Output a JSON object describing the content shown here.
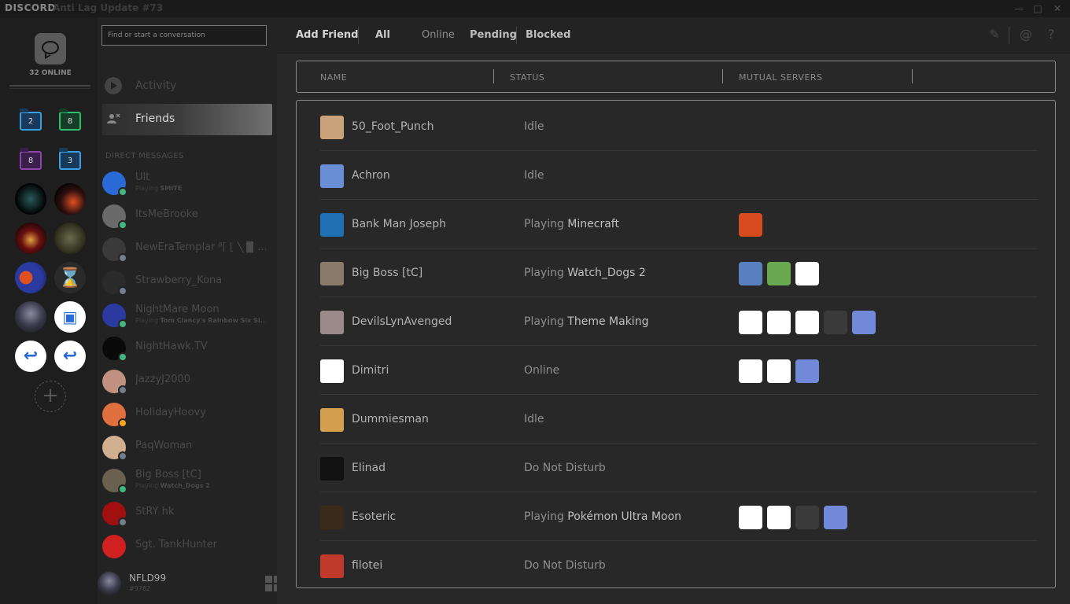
{
  "titlebar": {
    "brand": "DISCORD",
    "title": "Anti Lag Update #73",
    "minimize_icon": "minimize-icon",
    "maximize_icon": "maximize-icon",
    "close_icon": "close-icon"
  },
  "guilds": {
    "online_count": "32 ONLINE",
    "folders": [
      {
        "count": "2",
        "color": "#3aa0e6"
      },
      {
        "count": "8",
        "color": "#2fbf71"
      },
      {
        "count": "8",
        "color": "#8e44ad"
      },
      {
        "count": "3",
        "color": "#3aa0e6"
      }
    ],
    "add_server_icon": "plus-icon"
  },
  "dm": {
    "search_placeholder": "Find or start a conversation",
    "nav": [
      {
        "label": "Activity",
        "icon": "play-icon"
      },
      {
        "label": "Friends",
        "icon": "friends-icon"
      }
    ],
    "header": "DIRECT MESSAGES",
    "items": [
      {
        "name": "Ult",
        "sub_prefix": "Playing ",
        "sub_game": "SMITE",
        "status_color": "#43b581"
      },
      {
        "name": "ItsMeBrooke",
        "sub_prefix": "",
        "sub_game": "",
        "status_color": "#43b581"
      },
      {
        "name": "NewEraTemplar ᵝ⌈ ⌊ ╲ ▉ ...",
        "sub_prefix": "",
        "sub_game": "",
        "status_color": "#747f8d"
      },
      {
        "name": "Strawberry_Kona",
        "sub_prefix": "",
        "sub_game": "",
        "status_color": "#747f8d"
      },
      {
        "name": "NightMare Moon",
        "sub_prefix": "Playing ",
        "sub_game": "Tom Clancy's Rainbow Six Si...",
        "status_color": "#43b581"
      },
      {
        "name": "NightHawk.TV",
        "sub_prefix": "",
        "sub_game": "",
        "status_color": "#43b581"
      },
      {
        "name": "JazzyJ2000",
        "sub_prefix": "",
        "sub_game": "",
        "status_color": "#747f8d"
      },
      {
        "name": "HolidayHoovy",
        "sub_prefix": "",
        "sub_game": "",
        "status_color": "#faa61a"
      },
      {
        "name": "PaqWoman",
        "sub_prefix": "",
        "sub_game": "",
        "status_color": "#747f8d"
      },
      {
        "name": "Big Boss [tC]",
        "sub_prefix": "Playing ",
        "sub_game": "Watch_Dogs 2",
        "status_color": "#43b581"
      },
      {
        "name": "StRY hk",
        "sub_prefix": "",
        "sub_game": "",
        "status_color": "#747f8d"
      },
      {
        "name": "Sgt. TankHunter",
        "sub_prefix": "",
        "sub_game": "",
        "status_color": ""
      }
    ],
    "user": {
      "name": "NFLD99",
      "discriminator": "#9782"
    }
  },
  "topbar": {
    "tabs": [
      "Add Friend",
      "All",
      "Online",
      "Pending",
      "Blocked"
    ],
    "icons": [
      "new-group-icon",
      "mention-icon",
      "help-icon"
    ]
  },
  "table": {
    "headers": [
      "NAME",
      "STATUS",
      "MUTUAL SERVERS"
    ],
    "rows": [
      {
        "name": "50_Foot_Punch",
        "status": "Idle",
        "game": "",
        "avatar_color": "#c9a27a",
        "servers": []
      },
      {
        "name": "Achron",
        "status": "Idle",
        "game": "",
        "avatar_color": "#6b8fd6",
        "servers": []
      },
      {
        "name": "Bank Man Joseph",
        "status": "Playing ",
        "game": "Minecraft",
        "avatar_color": "#1e6fb3",
        "servers": [
          "#d64a1e"
        ]
      },
      {
        "name": "Big Boss [tC]",
        "status": "Playing ",
        "game": "Watch_Dogs 2",
        "avatar_color": "#8a7a6a",
        "servers": [
          "#5a7fc0",
          "#6aa84f",
          "#ffffff"
        ]
      },
      {
        "name": "DevilsLynAvenged",
        "status": "Playing ",
        "game": "Theme Making",
        "avatar_color": "#9a8a8a",
        "servers": [
          "#ffffff",
          "#ffffff",
          "#ffffff",
          "#3a3a3a",
          "#7289da"
        ]
      },
      {
        "name": "Dimitri",
        "status": "Online",
        "game": "",
        "avatar_color": "#ffffff",
        "servers": [
          "#ffffff",
          "#ffffff",
          "#7289da"
        ]
      },
      {
        "name": "Dummiesman",
        "status": "Idle",
        "game": "",
        "avatar_color": "#d4a050",
        "servers": []
      },
      {
        "name": "Elinad",
        "status": "Do Not Disturb",
        "game": "",
        "avatar_color": "#111111",
        "servers": []
      },
      {
        "name": "Esoteric",
        "status": "Playing ",
        "game": "Pokémon Ultra Moon",
        "avatar_color": "#3a2a1a",
        "servers": [
          "#ffffff",
          "#ffffff",
          "#3a3a3a",
          "#7289da"
        ]
      },
      {
        "name": "filotei",
        "status": "Do Not Disturb",
        "game": "",
        "avatar_color": "#c0392b",
        "servers": []
      }
    ]
  }
}
